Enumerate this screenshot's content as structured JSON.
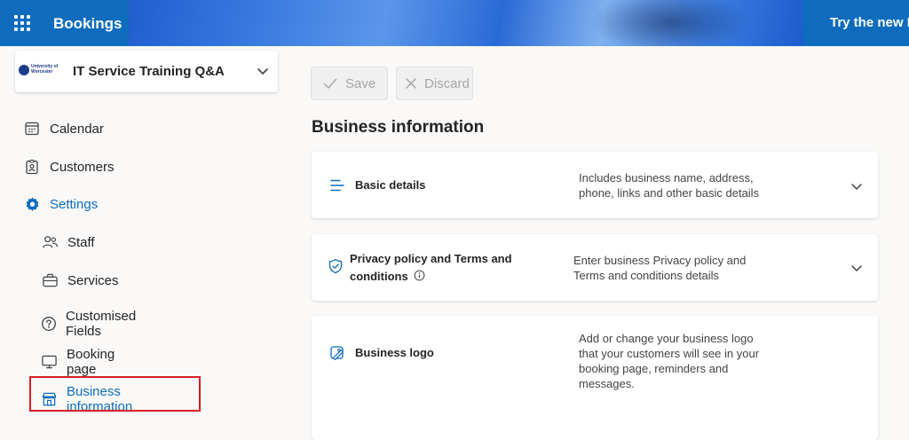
{
  "header": {
    "app_title": "Bookings",
    "promo_text": "Try the new B"
  },
  "business_selector": {
    "logo_text": "University of Worcester",
    "name": "IT Service Training Q&A"
  },
  "nav": {
    "calendar": "Calendar",
    "customers": "Customers",
    "settings": "Settings",
    "staff": "Staff",
    "services": "Services",
    "customised_fields": "Customised Fields",
    "booking_page": "Booking page",
    "business_information": "Business information"
  },
  "toolbar": {
    "save_label": "Save",
    "discard_label": "Discard"
  },
  "main": {
    "section_title": "Business information",
    "cards": [
      {
        "title": "Basic details",
        "description": "Includes business name, address, phone, links and other basic details"
      },
      {
        "title": "Privacy policy and Terms and conditions",
        "description": "Enter business Privacy policy and Terms and conditions details"
      },
      {
        "title": "Business logo",
        "description": "Add or change your business logo that your customers will see in your booking page, reminders and messages."
      }
    ]
  },
  "colors": {
    "accent": "#0f6cbd",
    "highlight": "#d81f26"
  }
}
